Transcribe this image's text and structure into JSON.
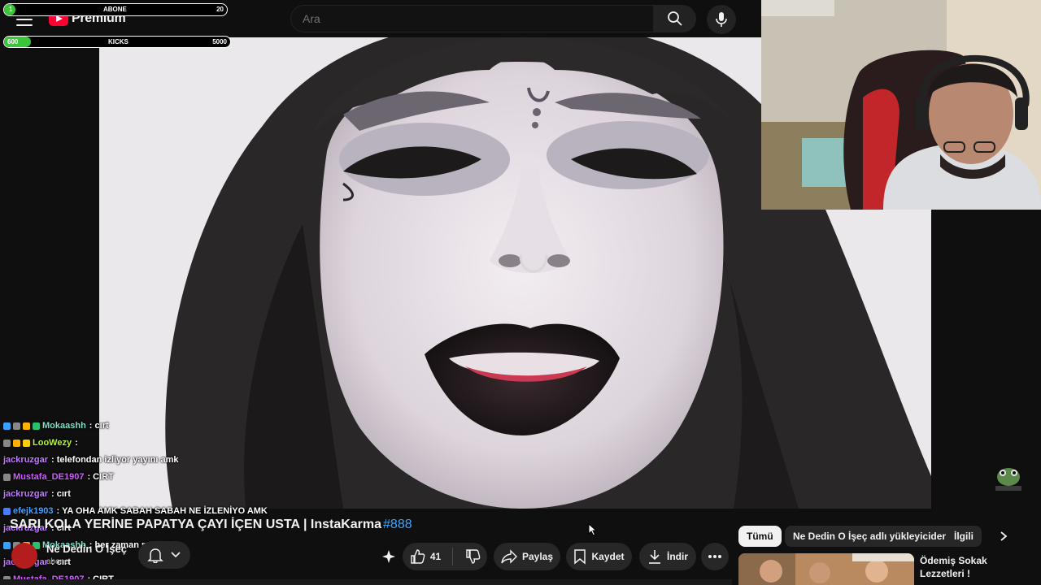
{
  "header": {
    "logo_text": "Premium",
    "search_placeholder": "Ara"
  },
  "overlay": {
    "subscribe_goal": {
      "label": "ABONE",
      "current": "1",
      "target": "20",
      "progress_fraction": 0.05
    },
    "kicks_goal": {
      "label": "KICKS",
      "current": "600",
      "target": "5000",
      "progress_fraction": 0.12
    }
  },
  "chat": [
    {
      "user": "Mokaashh",
      "message": ": cırt",
      "color": "#7ee0c8",
      "badges": [
        "#39a0ff",
        "#888888",
        "#ffb300",
        "#2bc06d"
      ]
    },
    {
      "user": "LooWezy",
      "message": ":",
      "color": "#b7f53a",
      "badges": [
        "#888888",
        "#ffb300",
        "#ffcc00"
      ]
    },
    {
      "user": "jackruzgar",
      "message": ": telefondan izliyor yayını amk",
      "color": "#c07bff",
      "badges": []
    },
    {
      "user": "Mustafa_DE1907",
      "message": ": CIRT",
      "color": "#d05cff",
      "badges": [
        "#888888"
      ]
    },
    {
      "user": "jackruzgar",
      "message": ": cırt",
      "color": "#c07bff",
      "badges": []
    },
    {
      "user": "efejk1903",
      "message": ": YA OHA AMK SABAH SABAH NE İZLENİYO AMK",
      "color": "#4aa3ff",
      "badges": [
        "#4a7cff"
      ]
    },
    {
      "user": "jackruzgar",
      "message": ": cırt",
      "color": "#c07bff",
      "badges": []
    },
    {
      "user": "Mokaashh",
      "message": ": her zaman müsaitim",
      "color": "#7ee0c8",
      "badges": [
        "#39a0ff",
        "#888888",
        "#ffb300",
        "#2bc06d"
      ]
    },
    {
      "user": "jackruzgar",
      "message": ": cırt",
      "color": "#c07bff",
      "badges": []
    },
    {
      "user": "Mustafa_DE1907",
      "message": ": CIRT",
      "color": "#d05cff",
      "badges": [
        "#888888"
      ]
    }
  ],
  "video": {
    "title": "SARI KOLA YERİNE PAPATYA ÇAYI İÇEN USTA | InstaKarma",
    "title_tag": "#888",
    "channel_name": "Ne Dedin O İşeç",
    "channel_subs": "abone",
    "likes": "41"
  },
  "actions": {
    "share_label": "Paylaş",
    "save_label": "Kaydet",
    "download_label": "İndir"
  },
  "chips": [
    "Tümü",
    "Ne Dedin O İşeç adlı yükleyiciden",
    "İlgili"
  ],
  "related": [
    {
      "title": "Ödemiş Sokak Lezzetleri !"
    }
  ],
  "colors": {
    "background": "#0f0f0f",
    "brand_red": "#ff0033",
    "hashtag_blue": "#3ea6ff",
    "button_bg": "#272727"
  }
}
